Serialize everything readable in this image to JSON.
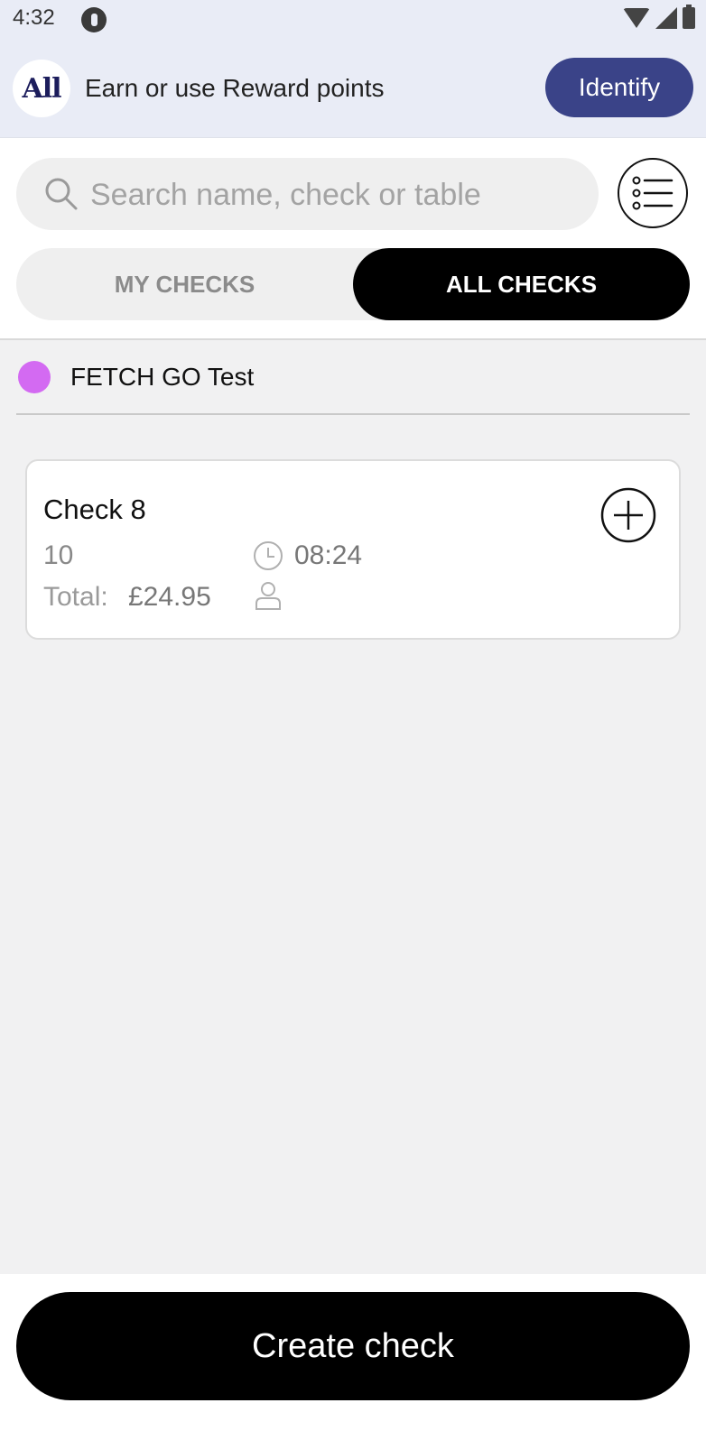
{
  "status_bar": {
    "time": "4:32",
    "icons": [
      "app-notification-icon",
      "wifi-icon",
      "signal-icon",
      "battery-icon"
    ]
  },
  "reward_banner": {
    "logo_text": "All",
    "text": "Earn or use Reward points",
    "identify_label": "Identify",
    "button_color": "#3a4388"
  },
  "search": {
    "placeholder": "Search name, check or table",
    "value": ""
  },
  "tabs": [
    {
      "label": "MY CHECKS",
      "selected": false
    },
    {
      "label": "ALL CHECKS",
      "selected": true
    }
  ],
  "location": {
    "name": "FETCH GO Test",
    "dot_color": "#d36af2"
  },
  "checks": [
    {
      "title": "Check 8",
      "table": "10",
      "time": "08:24",
      "total_label": "Total:",
      "total_value": "£24.95"
    }
  ],
  "footer": {
    "create_label": "Create check"
  }
}
